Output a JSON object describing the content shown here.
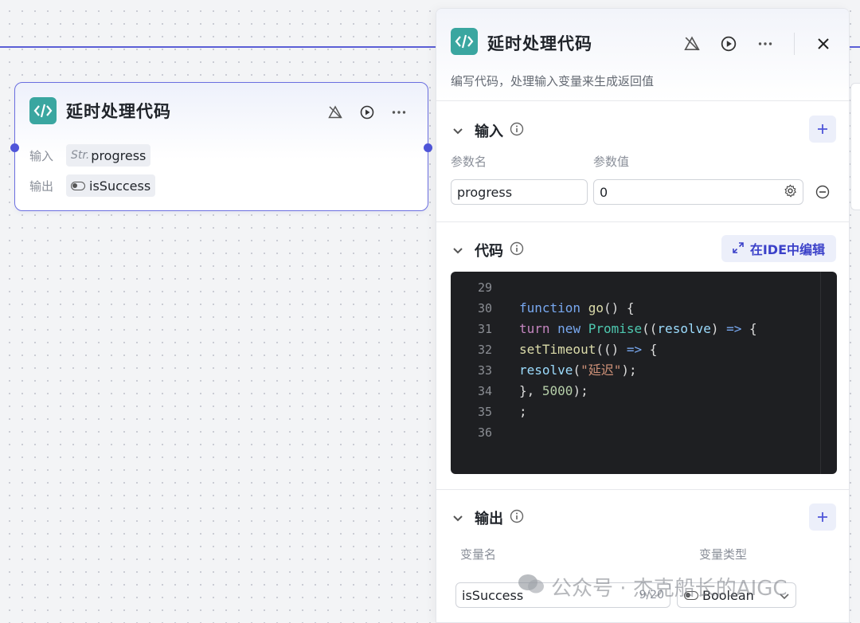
{
  "node": {
    "title": "延时处理代码",
    "input_label": "输入",
    "input_type": "Str.",
    "input_value": "progress",
    "output_label": "输出",
    "output_value": "isSuccess"
  },
  "panel": {
    "title": "延时处理代码",
    "description": "编写代码，处理输入变量来生成返回值",
    "input_section": {
      "title": "输入",
      "col_name": "参数名",
      "col_value": "参数值",
      "param_name": "progress",
      "param_value": "0"
    },
    "code_section": {
      "title": "代码",
      "ide_button": "在IDE中编辑",
      "lines": [
        {
          "n": "29",
          "code": ""
        },
        {
          "n": "30",
          "code": "function go() {"
        },
        {
          "n": "31",
          "code": "turn new Promise((resolve) => {"
        },
        {
          "n": "32",
          "code": "  setTimeout(() => {"
        },
        {
          "n": "33",
          "code": "      resolve(\"延迟\");"
        },
        {
          "n": "34",
          "code": "  }, 5000);"
        },
        {
          "n": "35",
          "code": ";"
        },
        {
          "n": "36",
          "code": ""
        }
      ]
    },
    "output_section": {
      "title": "输出",
      "col_name": "变量名",
      "col_type": "变量类型",
      "var_name": "isSuccess",
      "char_count": "9/20",
      "var_type": "Boolean"
    }
  },
  "watermark": "公众号 · 杰克船长的AIGC",
  "colors": {
    "accent": "#4f55d9",
    "icon_bg": "#3aa6a0",
    "code_bg": "#1e1f22"
  }
}
